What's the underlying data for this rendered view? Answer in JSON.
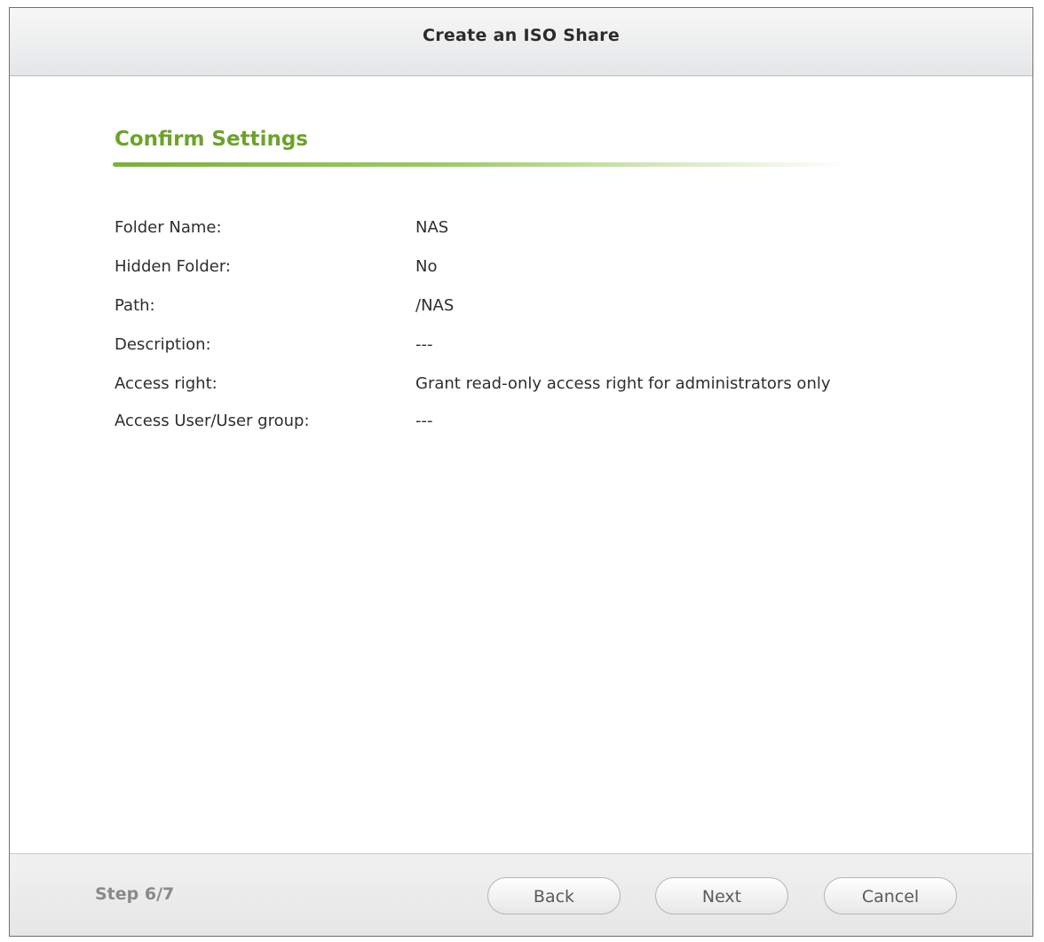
{
  "dialog": {
    "title": "Create an ISO Share"
  },
  "section": {
    "title": "Confirm Settings"
  },
  "settings": [
    {
      "label": "Folder Name:",
      "value": "NAS"
    },
    {
      "label": "Hidden Folder:",
      "value": "No"
    },
    {
      "label": "Path:",
      "value": "/NAS"
    },
    {
      "label": "Description:",
      "value": "---"
    },
    {
      "label": "Access right:",
      "value": "Grant read-only access right for administrators only"
    },
    {
      "label": "Access User/User group:",
      "value": "---"
    }
  ],
  "footer": {
    "step": "Step 6/7",
    "back_label": "Back",
    "next_label": "Next",
    "cancel_label": "Cancel"
  },
  "colors": {
    "accent_green": "#6da22a",
    "text": "#2e2e2e",
    "step_text": "#8a8a8a"
  }
}
